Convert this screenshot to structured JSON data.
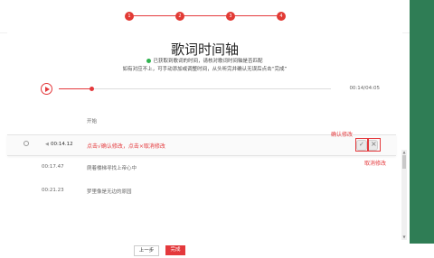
{
  "colors": {
    "accent": "#e4393c",
    "right_bar": "#2f7d55",
    "success": "#2fb24f"
  },
  "steps": [
    "1",
    "2",
    "3",
    "4"
  ],
  "title": "歌词时间轴",
  "notes": {
    "line1": "已获取到歌词的时间，请核对歌词时间轴是否匹配",
    "line2": "如有对应不上，可手动添加或调整时间，从头听完并确认无误后点击“完成”"
  },
  "player": {
    "time_readout": "00:14/04:05",
    "progress": 0.12
  },
  "rows": [
    {
      "time": "",
      "text": "开始"
    },
    {
      "time": "00:14.12",
      "text": "点击√确认修改，点击×取消修改",
      "active": true
    },
    {
      "time": "00:17.47",
      "text": "爬着楼梯寻找上帝心中"
    },
    {
      "time": "00:21.23",
      "text": "梦里像是无边的原园"
    }
  ],
  "callouts": {
    "confirm": "确认修改",
    "cancel": "取消修改"
  },
  "buttons": {
    "prev": "上一步",
    "next": "完成"
  }
}
